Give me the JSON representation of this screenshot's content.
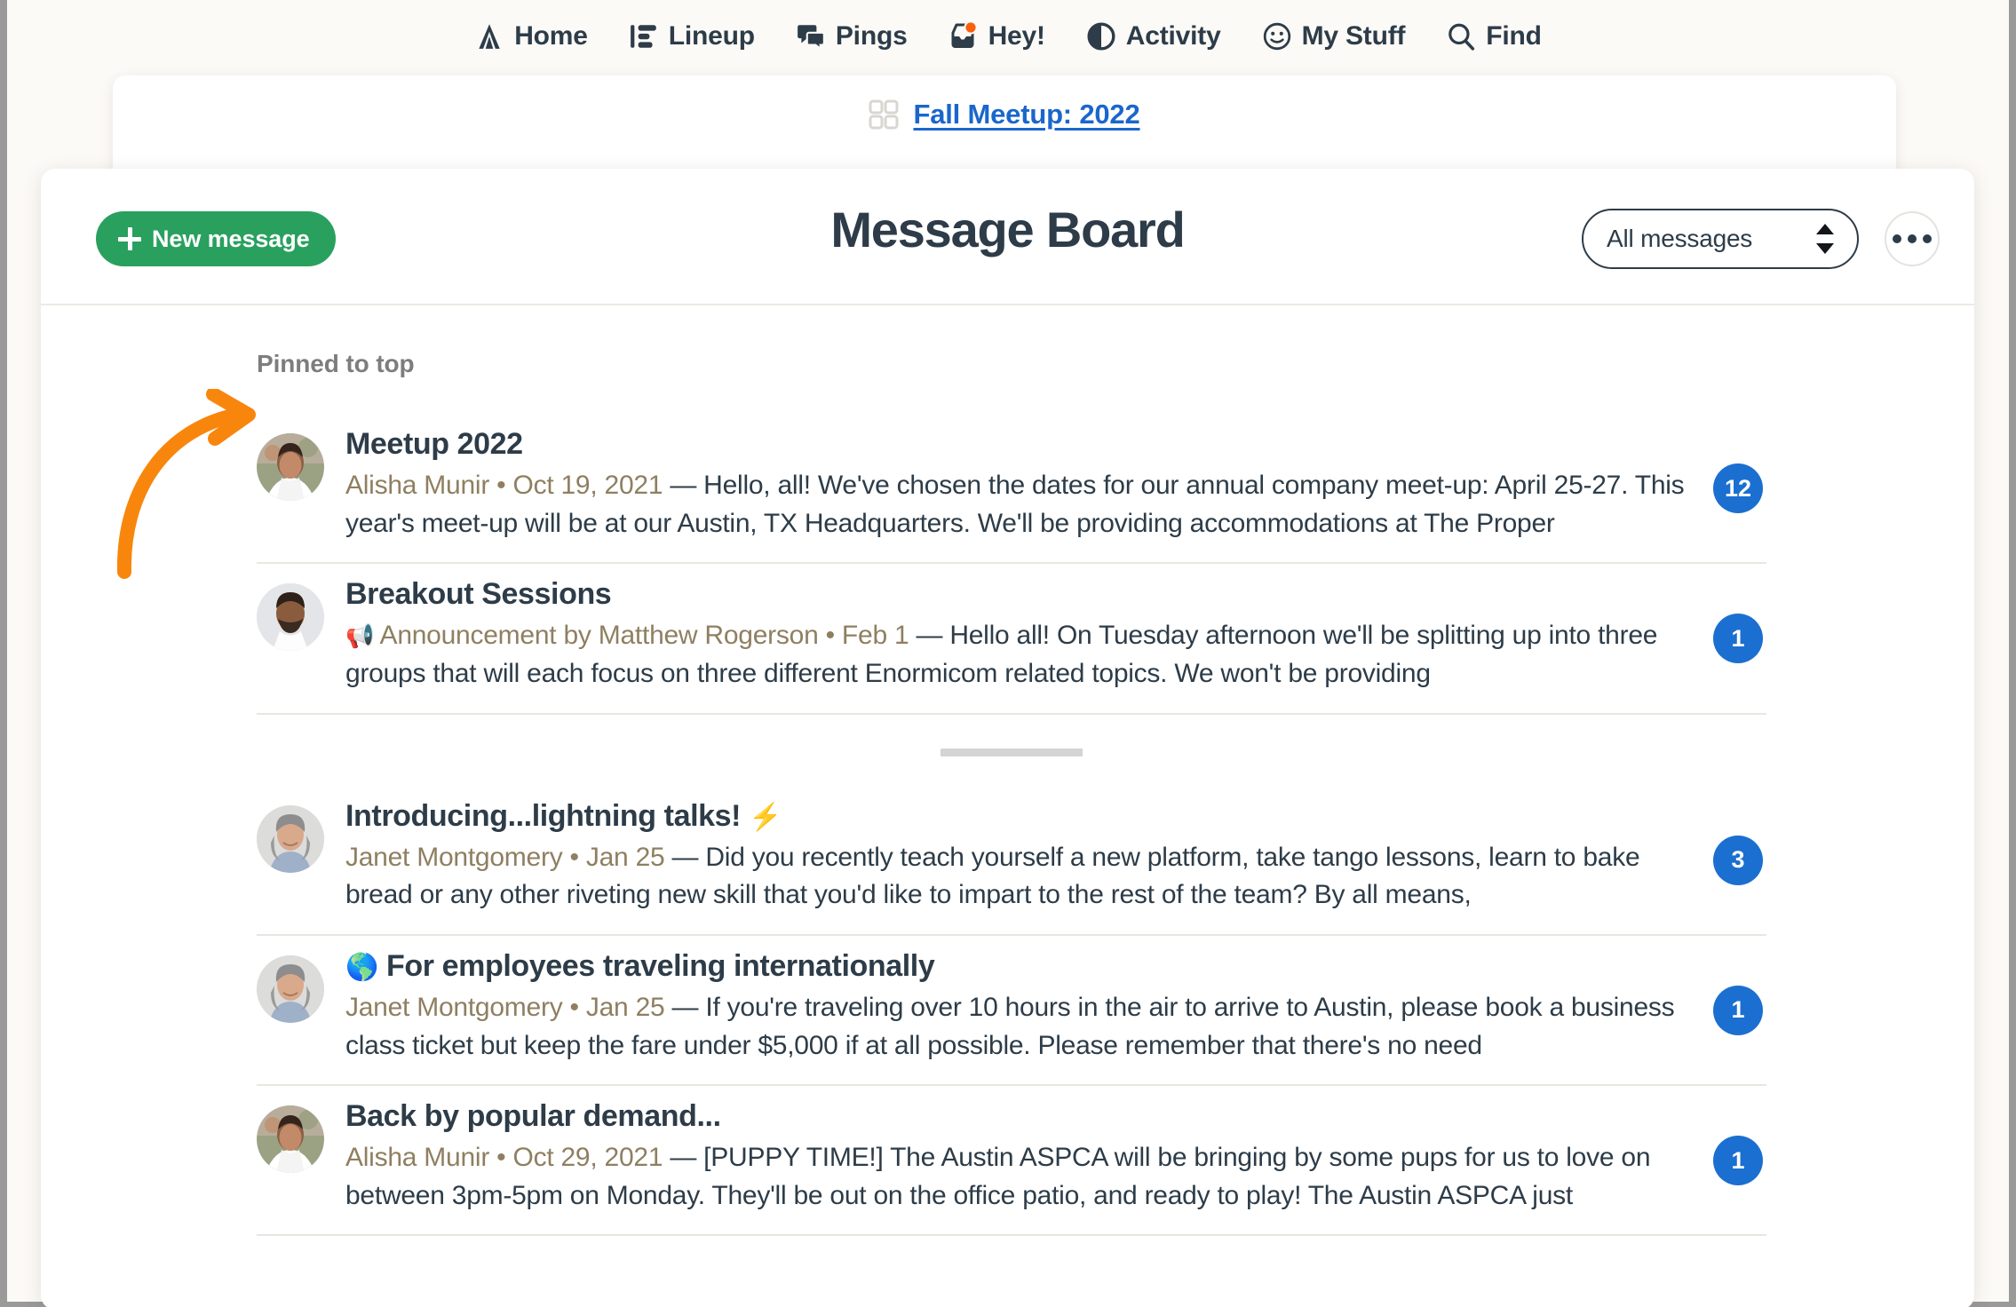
{
  "topnav": {
    "items": [
      {
        "label": "Home",
        "icon": "home-tent-icon"
      },
      {
        "label": "Lineup",
        "icon": "lineup-list-icon"
      },
      {
        "label": "Pings",
        "icon": "pings-chat-icon"
      },
      {
        "label": "Hey!",
        "icon": "hey-inbox-icon",
        "badge": true
      },
      {
        "label": "Activity",
        "icon": "activity-pie-icon"
      },
      {
        "label": "My Stuff",
        "icon": "my-stuff-smiley-icon"
      },
      {
        "label": "Find",
        "icon": "search-icon"
      }
    ]
  },
  "project_card": {
    "icon": "grid-squares-icon",
    "link_label": "Fall Meetup: 2022"
  },
  "toolbar": {
    "new_message_label": "New message",
    "title": "Message Board",
    "filter_value": "All messages",
    "filter_options": [
      "All messages"
    ],
    "more_menu_label": "..."
  },
  "board": {
    "pinned_label": "Pinned to top",
    "pinned_messages": [
      {
        "title": "Meetup 2022",
        "title_emoji": "",
        "byline_emoji": "",
        "author": "Alisha Munir",
        "date": "Oct 19, 2021",
        "byline": "Alisha Munir • Oct 19, 2021",
        "excerpt": " — Hello, all! We've chosen the dates for our annual company meet-up: April 25-27. This year's meet-up will be at our Austin, TX Headquarters. We'll be providing accommodations at The Proper",
        "comment_count": "12",
        "avatar": "avatar-alisha"
      },
      {
        "title": "Breakout Sessions",
        "title_emoji": "",
        "byline_emoji": "📢",
        "author": "Matthew Rogerson",
        "date": "Feb 1",
        "byline": " Announcement by Matthew Rogerson • Feb 1",
        "excerpt": " — Hello all! On Tuesday afternoon we'll be splitting up into three groups that will each focus on three different Enormicom related topics.  We won't be providing",
        "comment_count": "1",
        "avatar": "avatar-matthew"
      }
    ],
    "messages": [
      {
        "title": "Introducing...lightning talks!",
        "title_emoji": "⚡",
        "byline_emoji": "",
        "author": "Janet Montgomery",
        "date": "Jan 25",
        "byline": "Janet Montgomery • Jan 25",
        "excerpt": " — Did you recently teach yourself a new platform, take tango lessons, learn to bake bread or any other riveting new skill that you'd like to impart to the rest of the team? By all means,",
        "comment_count": "3",
        "avatar": "avatar-janet"
      },
      {
        "title": "For employees traveling internationally",
        "title_emoji": "🌎",
        "title_emoji_position": "before",
        "byline_emoji": "",
        "author": "Janet Montgomery",
        "date": "Jan 25",
        "byline": "Janet Montgomery • Jan 25",
        "excerpt": " — If you're traveling over 10 hours in the air to arrive to Austin, please book a business class ticket but keep the fare under $5,000 if at all possible. Please remember that there's no need",
        "comment_count": "1",
        "avatar": "avatar-janet"
      },
      {
        "title": "Back by popular demand...",
        "title_emoji": "",
        "byline_emoji": "",
        "author": "Alisha Munir",
        "date": "Oct 29, 2021",
        "byline": "Alisha Munir • Oct 29, 2021",
        "excerpt": " — [PUPPY TIME!] The Austin ASPCA will be bringing by some pups for us to love on between 3pm-5pm on Monday. They'll be out on the office patio, and ready to play! The Austin ASPCA just",
        "comment_count": "1",
        "avatar": "avatar-alisha"
      }
    ]
  },
  "annotation": {
    "arrow": "curved-orange-arrow",
    "arrow_color": "#f8860d"
  },
  "colors": {
    "accent_green": "#29a05e",
    "accent_blue": "#1b6fd0",
    "link_blue": "#1a66cc",
    "text_dark": "#2d3c48",
    "byline_brown": "#8f7f61",
    "page_bg": "#fcfaf7",
    "arrow_orange": "#f8860d"
  }
}
